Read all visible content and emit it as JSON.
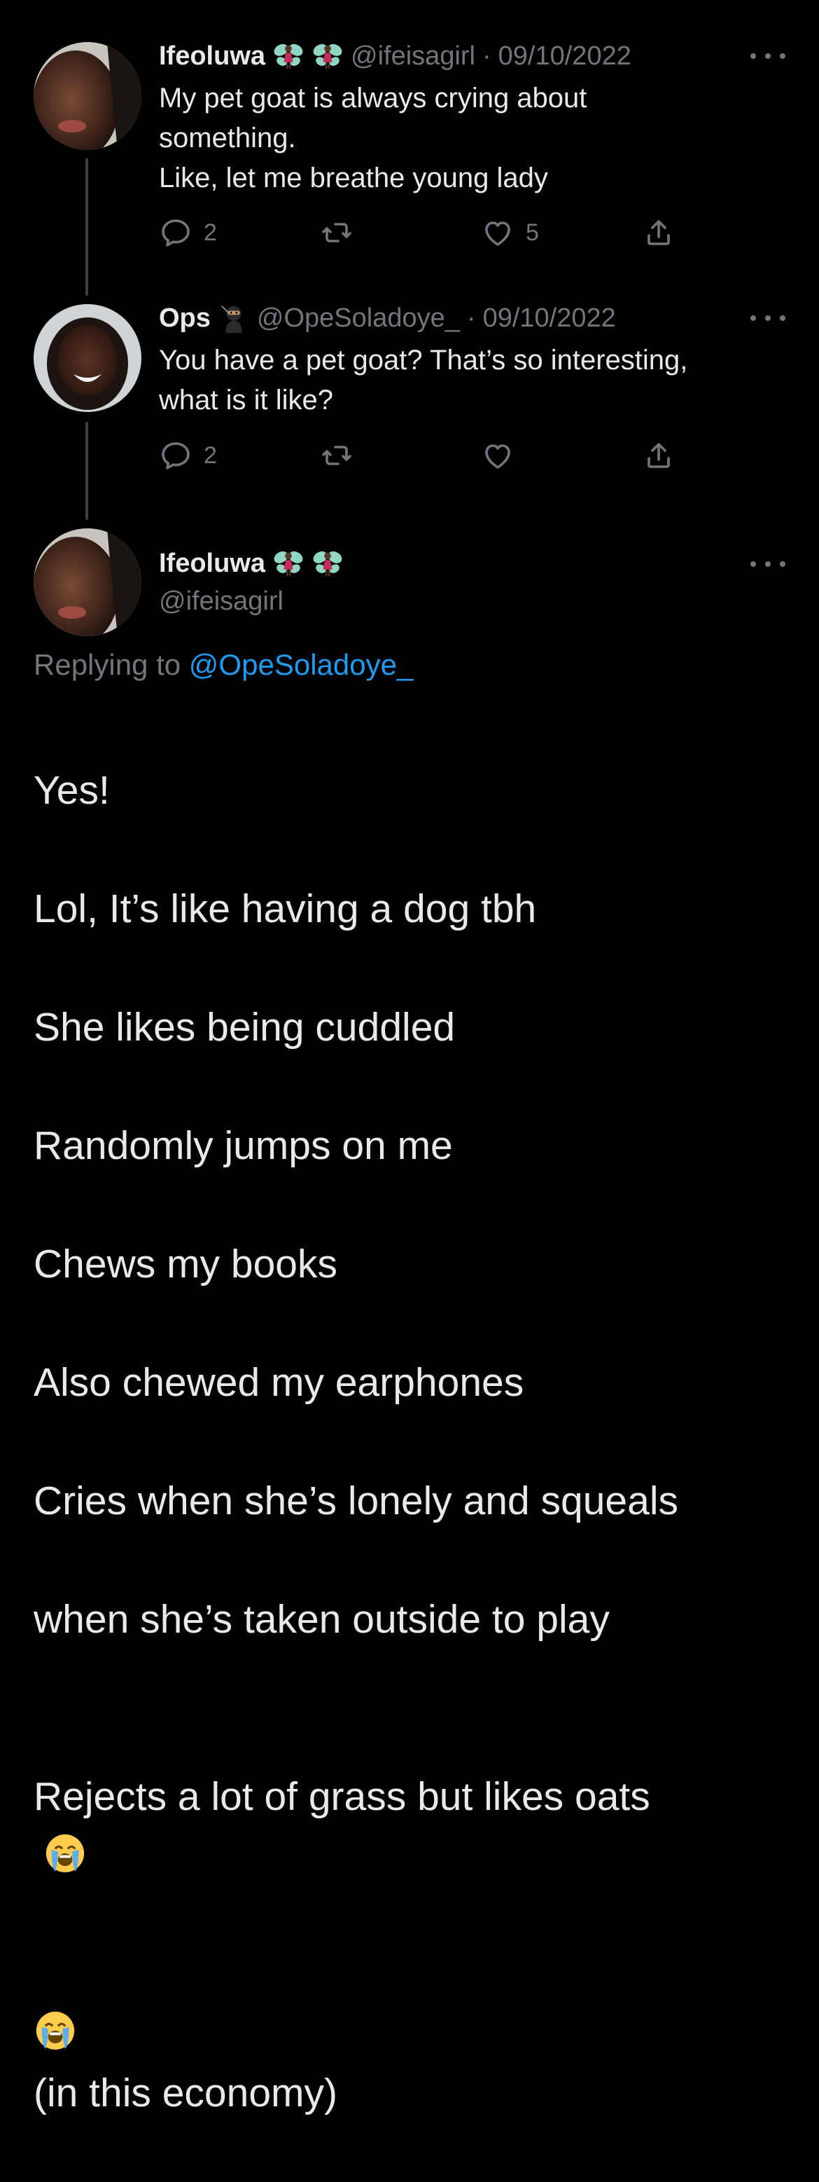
{
  "tweets": [
    {
      "name": "Ifeoluwa",
      "handle": "@ifeisagirl",
      "separator": "·",
      "date": "09/10/2022",
      "emojis": [
        "fairy-emoji",
        "fairy-emoji"
      ],
      "text": "My pet goat is always crying about\nsomething.\nLike, let me breathe young lady",
      "stats": {
        "replies": "2",
        "retweets": "",
        "likes": "5"
      }
    },
    {
      "name": "Ops",
      "handle": "@OpeSoladoye_",
      "separator": "·",
      "date": "09/10/2022",
      "emojis": [
        "ninja-emoji"
      ],
      "text": "You have a pet goat? That’s so interesting,\nwhat is it like?",
      "stats": {
        "replies": "2",
        "retweets": "",
        "likes": ""
      }
    }
  ],
  "main_tweet": {
    "name": "Ifeoluwa",
    "handle": "@ifeisagirl",
    "emojis": [
      "fairy-emoji",
      "fairy-emoji"
    ],
    "replying_label": "Replying to",
    "replying_to": "@OpeSoladoye_",
    "lines": [
      "Yes!",
      "Lol, It’s like having a dog tbh",
      "She likes being cuddled",
      "Randomly jumps on me",
      "Chews my books",
      "Also chewed my earphones",
      "Cries when she’s lonely and squeals",
      "when she’s taken outside to play",
      "Rejects a lot of grass but likes oats",
      "(in this economy)"
    ],
    "trailing_emojis": [
      "loudly-crying-face-emoji",
      "loudly-crying-face-emoji"
    ]
  },
  "colors": {
    "background": "#000000",
    "text": "#e7e9ea",
    "secondary": "#71767b",
    "link": "#1d9bf0",
    "thread_line": "#3e4144"
  }
}
